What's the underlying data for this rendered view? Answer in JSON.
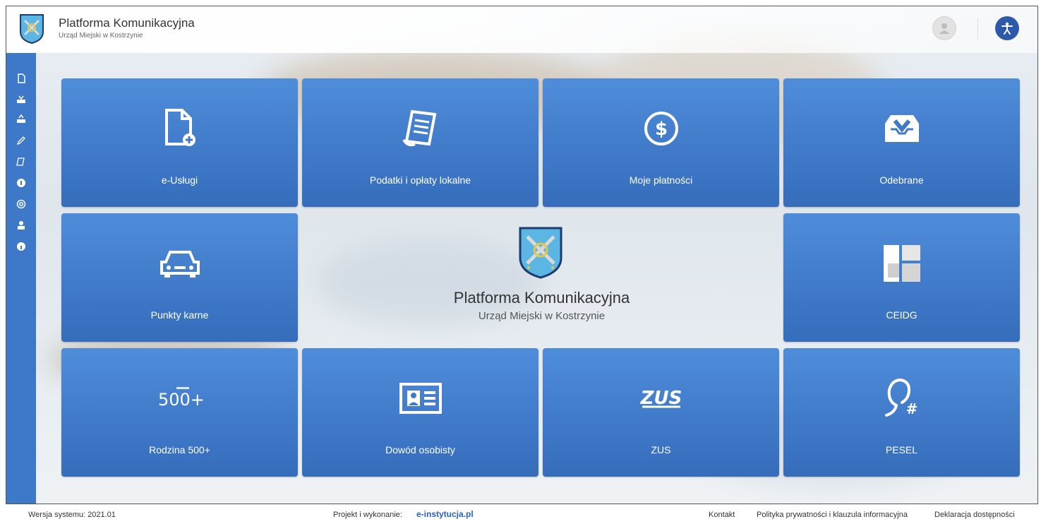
{
  "header": {
    "title": "Platforma Komunikacyjna",
    "subtitle": "Urząd Miejski w Kostrzynie"
  },
  "sidebar": {
    "items": [
      {
        "icon": "new-document-icon"
      },
      {
        "icon": "inbox-icon"
      },
      {
        "icon": "outbox-icon"
      },
      {
        "icon": "pencil-icon"
      },
      {
        "icon": "tax-icon"
      },
      {
        "icon": "payment-icon"
      },
      {
        "icon": "at-sign-icon"
      },
      {
        "icon": "user-icon"
      },
      {
        "icon": "help-icon"
      }
    ]
  },
  "tiles": [
    {
      "label": "e-Usługi",
      "icon": "new-document-icon"
    },
    {
      "label": "Podatki i opłaty lokalne",
      "icon": "receipt-icon"
    },
    {
      "label": "Moje płatności",
      "icon": "dollar-coin-icon"
    },
    {
      "label": "Odebrane",
      "icon": "inbox-tray-icon"
    },
    {
      "label": "Punkty karne",
      "icon": "car-icon"
    },
    {
      "label": "CEIDG",
      "icon": "ceidg-logo-icon"
    },
    {
      "label": "Rodzina 500+",
      "icon": "rodzina-500-logo"
    },
    {
      "label": "Dowód osobisty",
      "icon": "id-card-icon"
    },
    {
      "label": "ZUS",
      "icon": "zus-logo"
    },
    {
      "label": "PESEL",
      "icon": "pesel-icon"
    }
  ],
  "center": {
    "title": "Platforma Komunikacyjna",
    "subtitle": "Urząd Miejski w Kostrzynie"
  },
  "footer": {
    "version": "Wersja systemu: 2021.01",
    "project": "Projekt i wykonanie:",
    "brand": "e-instytucja.pl",
    "contact": "Kontakt",
    "privacy": "Polityka prywatności i klauzula informacyjna",
    "declaration": "Deklaracja dostępności"
  },
  "colors": {
    "accent": "#3d78c9",
    "tile": "#4385d6",
    "a11y": "#2d5aa8"
  }
}
